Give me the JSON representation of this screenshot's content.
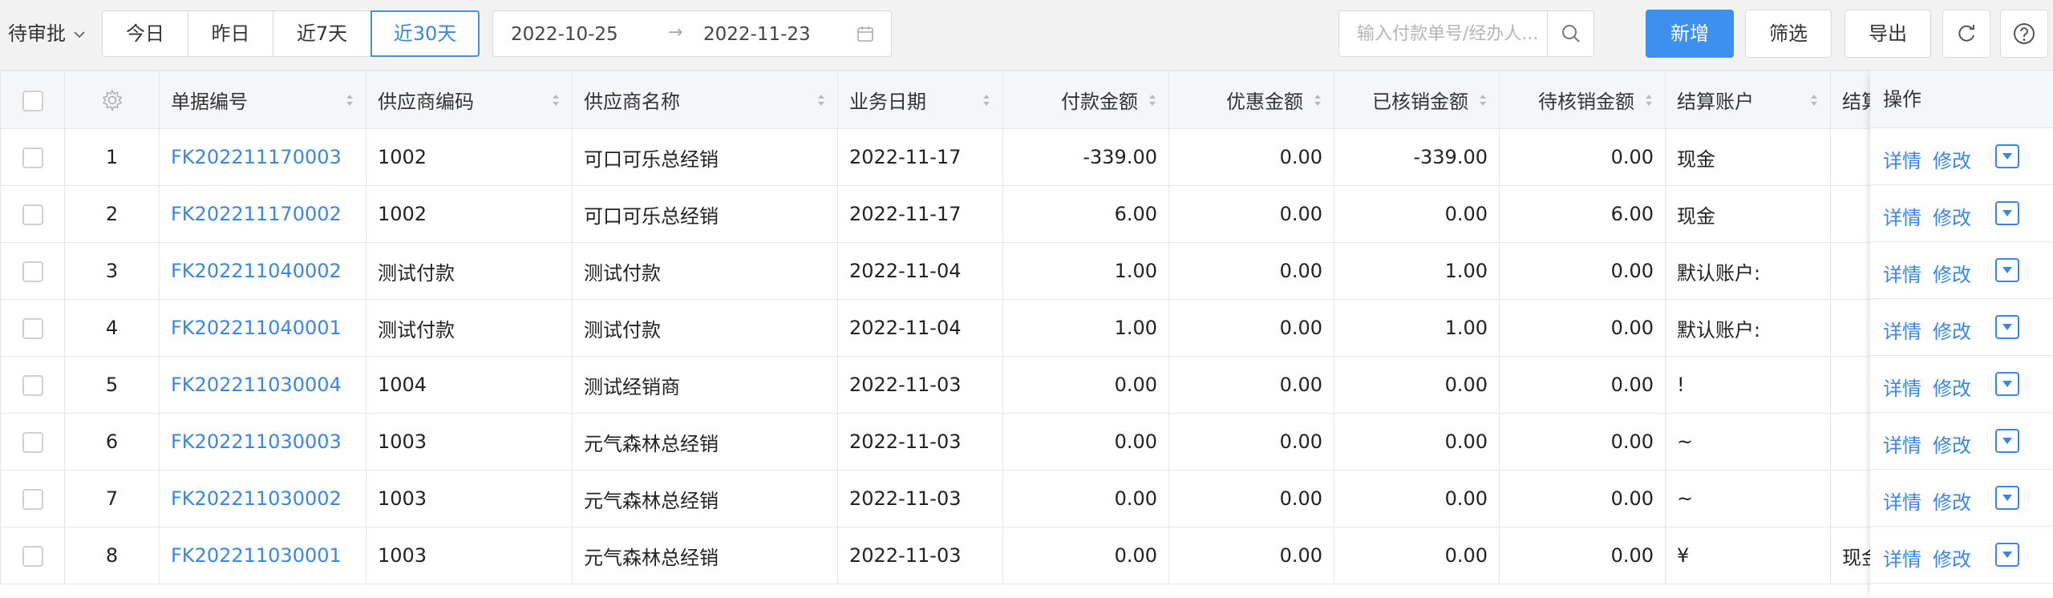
{
  "toolbar": {
    "status_filter": "待审批",
    "ranges": [
      {
        "label": "今日",
        "active": false
      },
      {
        "label": "昨日",
        "active": false
      },
      {
        "label": "近7天",
        "active": false
      },
      {
        "label": "近30天",
        "active": true
      }
    ],
    "date_start": "2022-10-25",
    "date_end": "2022-11-23",
    "date_separator": "→",
    "search_placeholder": "输入付款单号/经办人...",
    "search_value": "",
    "new_label": "新增",
    "filter_label": "筛选",
    "export_label": "导出",
    "accent_color": "#3d8ff0"
  },
  "table": {
    "columns": [
      {
        "key": "doc_no",
        "label": "单据编号",
        "sortable": true
      },
      {
        "key": "supplier_code",
        "label": "供应商编码",
        "sortable": true
      },
      {
        "key": "supplier_name",
        "label": "供应商名称",
        "sortable": true
      },
      {
        "key": "biz_date",
        "label": "业务日期",
        "sortable": true
      },
      {
        "key": "pay_amount",
        "label": "付款金额",
        "sortable": true
      },
      {
        "key": "discount",
        "label": "优惠金额",
        "sortable": true
      },
      {
        "key": "written_off",
        "label": "已核销金额",
        "sortable": true
      },
      {
        "key": "pending",
        "label": "待核销金额",
        "sortable": true
      },
      {
        "key": "account",
        "label": "结算账户",
        "sortable": true
      },
      {
        "key": "account2",
        "label": "结算方式",
        "sortable": false
      }
    ],
    "ops_header": "操作",
    "ops_actions": {
      "detail": "详情",
      "edit": "修改"
    },
    "rows": [
      {
        "index": "1",
        "doc_no": "FK202211170003",
        "supplier_code": "1002",
        "supplier_name": "可口可乐总经销",
        "biz_date": "2022-11-17",
        "pay_amount": "-339.00",
        "discount": "0.00",
        "written_off": "-339.00",
        "pending": "0.00",
        "account": "现金",
        "account2": ""
      },
      {
        "index": "2",
        "doc_no": "FK202211170002",
        "supplier_code": "1002",
        "supplier_name": "可口可乐总经销",
        "biz_date": "2022-11-17",
        "pay_amount": "6.00",
        "discount": "0.00",
        "written_off": "0.00",
        "pending": "6.00",
        "account": "现金",
        "account2": ""
      },
      {
        "index": "3",
        "doc_no": "FK202211040002",
        "supplier_code": "测试付款",
        "supplier_name": "测试付款",
        "biz_date": "2022-11-04",
        "pay_amount": "1.00",
        "discount": "0.00",
        "written_off": "1.00",
        "pending": "0.00",
        "account": "默认账户:",
        "account2": ""
      },
      {
        "index": "4",
        "doc_no": "FK202211040001",
        "supplier_code": "测试付款",
        "supplier_name": "测试付款",
        "biz_date": "2022-11-04",
        "pay_amount": "1.00",
        "discount": "0.00",
        "written_off": "1.00",
        "pending": "0.00",
        "account": "默认账户:",
        "account2": ""
      },
      {
        "index": "5",
        "doc_no": "FK202211030004",
        "supplier_code": "1004",
        "supplier_name": "测试经销商",
        "biz_date": "2022-11-03",
        "pay_amount": "0.00",
        "discount": "0.00",
        "written_off": "0.00",
        "pending": "0.00",
        "account": "!",
        "account2": ""
      },
      {
        "index": "6",
        "doc_no": "FK202211030003",
        "supplier_code": "1003",
        "supplier_name": "元气森林总经销",
        "biz_date": "2022-11-03",
        "pay_amount": "0.00",
        "discount": "0.00",
        "written_off": "0.00",
        "pending": "0.00",
        "account": "~",
        "account2": ""
      },
      {
        "index": "7",
        "doc_no": "FK202211030002",
        "supplier_code": "1003",
        "supplier_name": "元气森林总经销",
        "biz_date": "2022-11-03",
        "pay_amount": "0.00",
        "discount": "0.00",
        "written_off": "0.00",
        "pending": "0.00",
        "account": "~",
        "account2": ""
      },
      {
        "index": "8",
        "doc_no": "FK202211030001",
        "supplier_code": "1003",
        "supplier_name": "元气森林总经销",
        "biz_date": "2022-11-03",
        "pay_amount": "0.00",
        "discount": "0.00",
        "written_off": "0.00",
        "pending": "0.00",
        "account": "¥",
        "account2": "现金"
      }
    ]
  }
}
